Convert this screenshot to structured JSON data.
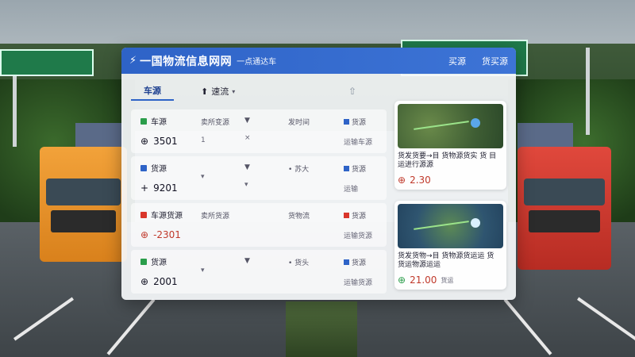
{
  "window": {
    "title": "一国物流信息网网",
    "subtitle": "一点通达车",
    "nav": [
      "买源",
      "货买源"
    ]
  },
  "toolbar": {
    "tab": "车源",
    "filter_label": "速流",
    "filter_caret": "▾",
    "upload_icon": "⇧"
  },
  "rows": [
    {
      "name": "车源",
      "color": "#2a9d4a",
      "price": "3501",
      "qty": "1",
      "caret": "▾",
      "route": "发时间",
      "x": "×",
      "status": "货源",
      "status_sub": "运输车源",
      "status_color": "#2e63c7",
      "col2": "卖所变源",
      "icon": "⊕"
    },
    {
      "name": "货源",
      "color": "#2e63c7",
      "price": "9201",
      "qty": "▾",
      "caret": "",
      "route": "• 苏大",
      "x": "▾",
      "status": "货源",
      "status_sub": "运输",
      "status_color": "#2e63c7",
      "col2": "",
      "icon": "+"
    },
    {
      "name": "车源货源",
      "color": "#d9362b",
      "price": "-2301",
      "qty": "",
      "caret": "",
      "route": "货物流",
      "x": "",
      "status": "货源",
      "status_sub": "运输货源",
      "status_color": "#d9362b",
      "col2": "卖所货源",
      "icon": "⊕"
    },
    {
      "name": "货源",
      "color": "#2a9d4a",
      "price": "2001",
      "qty": "▾",
      "caret": "",
      "route": "• 货头",
      "x": "",
      "status": "货源",
      "status_sub": "运输货源",
      "status_color": "#2e63c7",
      "col2": "",
      "icon": "⊕"
    }
  ],
  "cards": [
    {
      "text": "货发货要→目 货物源货实 货 目运进行源源",
      "amount": "2.30",
      "unit": "",
      "map": "green",
      "icon": "⊕"
    },
    {
      "text": "货发货物→目 货物源货运运 货 货运物源运运",
      "amount": "21.00",
      "unit": "货运",
      "map": "blue",
      "icon": "⊕"
    }
  ],
  "colors": {
    "title_bar": "#2e63c7",
    "accent_red": "#c0392b"
  }
}
